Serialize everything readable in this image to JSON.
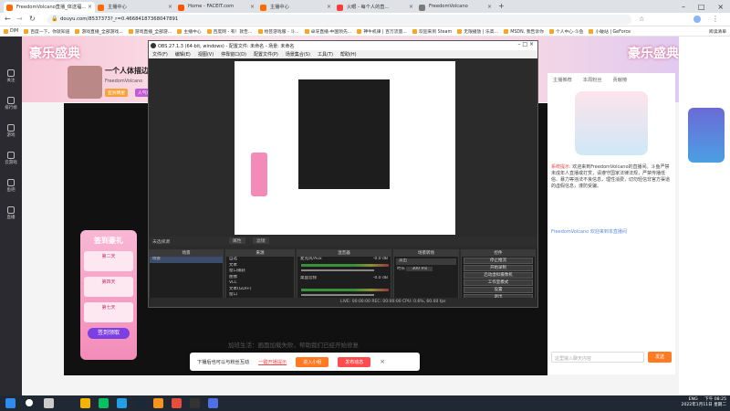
{
  "browser": {
    "tabs": [
      {
        "label": "FreedomVolcano直播_体送福...",
        "color": "#ff6a00"
      },
      {
        "label": "主播中心",
        "color": "#ff6a00"
      },
      {
        "label": "Home - FACEIT.com",
        "color": "#ff5500"
      },
      {
        "label": "主播中心",
        "color": "#ff6a00"
      },
      {
        "label": "火眼 - 每个人的直...",
        "color": "#ff3b3b"
      },
      {
        "label": "FreedomVolcano",
        "color": "#7a7a7a"
      }
    ],
    "url": "douyu.com/8537373?_r=0.46684187368047891",
    "bookmarks": [
      "DIM",
      "百度一下，你就知道",
      "游戏直播_全部游戏...",
      "游戏直播_全部游...",
      "主播中心",
      "百度网 - 有！就告...",
      "绘芸游戏服 - 斗...",
      "卓牙直播-中国领先...",
      "神牛机律 | 百万流量...",
      "欢迎来到 Steam",
      "无限播放 | 乐高...",
      "MSDN, 我告诉你",
      "个人中心-斗鱼",
      "小破站 | GeForce"
    ],
    "reading_list": "阅读清单"
  },
  "sidebar": {
    "items": [
      "关注",
      "排行榜",
      "游戏",
      "云游戏",
      "鱼吧",
      "直播"
    ]
  },
  "streamer": {
    "name": "一个人体描边的...",
    "id": "FreedomVolcano",
    "tag": "亚洲明星",
    "level_label": "人气值"
  },
  "banner": {
    "text": "豪乐盛典"
  },
  "obs": {
    "title": "OBS 27.1.3 (64-bit, windows) - 配置文件: 未命名 - 场景: 未命名",
    "menu": [
      "文件(F)",
      "编辑(E)",
      "视图(V)",
      "停靠窗口(D)",
      "配置文件(P)",
      "场景集合(S)",
      "工具(T)",
      "帮助(H)"
    ],
    "source_bar": "未选择源",
    "source_bar_buttons": [
      "属性",
      "滤镜"
    ],
    "docks": {
      "scenes": {
        "title": "场景",
        "items": [
          "场景"
        ]
      },
      "sources": {
        "title": "来源",
        "items": [
          "自选",
          "文本",
          "窗口捕获",
          "图像",
          "VLC",
          "文本(GDI+)",
          "窗口",
          "浏览器",
          "VLC",
          "窗口2"
        ]
      },
      "mixer": {
        "title": "混音器",
        "tracks": [
          {
            "name": "麦克风/Aux",
            "db": "-0.0 dB"
          },
          {
            "name": "桌面音频",
            "db": "-0.0 dB"
          }
        ]
      },
      "transitions": {
        "title": "场景转场",
        "type": "淡出",
        "duration_label": "时长",
        "duration": "300 ms"
      },
      "controls": {
        "title": "控件",
        "buttons": [
          "停止推流",
          "开始录制",
          "启动虚拟摄像机",
          "工作室模式",
          "设置",
          "退出"
        ]
      }
    },
    "status": "LIVE: 00:00:00   REC: 00:00:00   CPU: 0.6%, 60.00 fps"
  },
  "chat": {
    "tabs": [
      "主播推荐",
      "本周粉丝",
      "贡献榜"
    ],
    "system_label": "系统提示:",
    "system_message": "欢迎来到FreedomVolcano的直播间。斗鱼严禁未成年人直播或打赏，请遵守国家法律法规，严禁传播低俗、暴力等违法不良信息，理性消费，切勿轻信非官方渠道的虚假信息，谨防受骗。",
    "welcome": "FreedomVolcano 欢迎来到本直播间",
    "input_placeholder": "这里输入聊天内容",
    "send": "发送"
  },
  "signin": {
    "title": "签到豪礼",
    "days": [
      "第二天",
      "第四天",
      "第七天"
    ],
    "button": "签到领取"
  },
  "toast": {
    "text": "下播后也可以与粉丝互动",
    "link": "一键开播提示",
    "btn1": "进入小组",
    "btn2": "发布动态"
  },
  "subtitle": {
    "text": "加班生活：画面加载失败，帮助我们已经开始修复"
  },
  "taskbar": {
    "time": "下午 08:25",
    "date": "2022年1月11日 星期二",
    "lang": "ENG"
  }
}
